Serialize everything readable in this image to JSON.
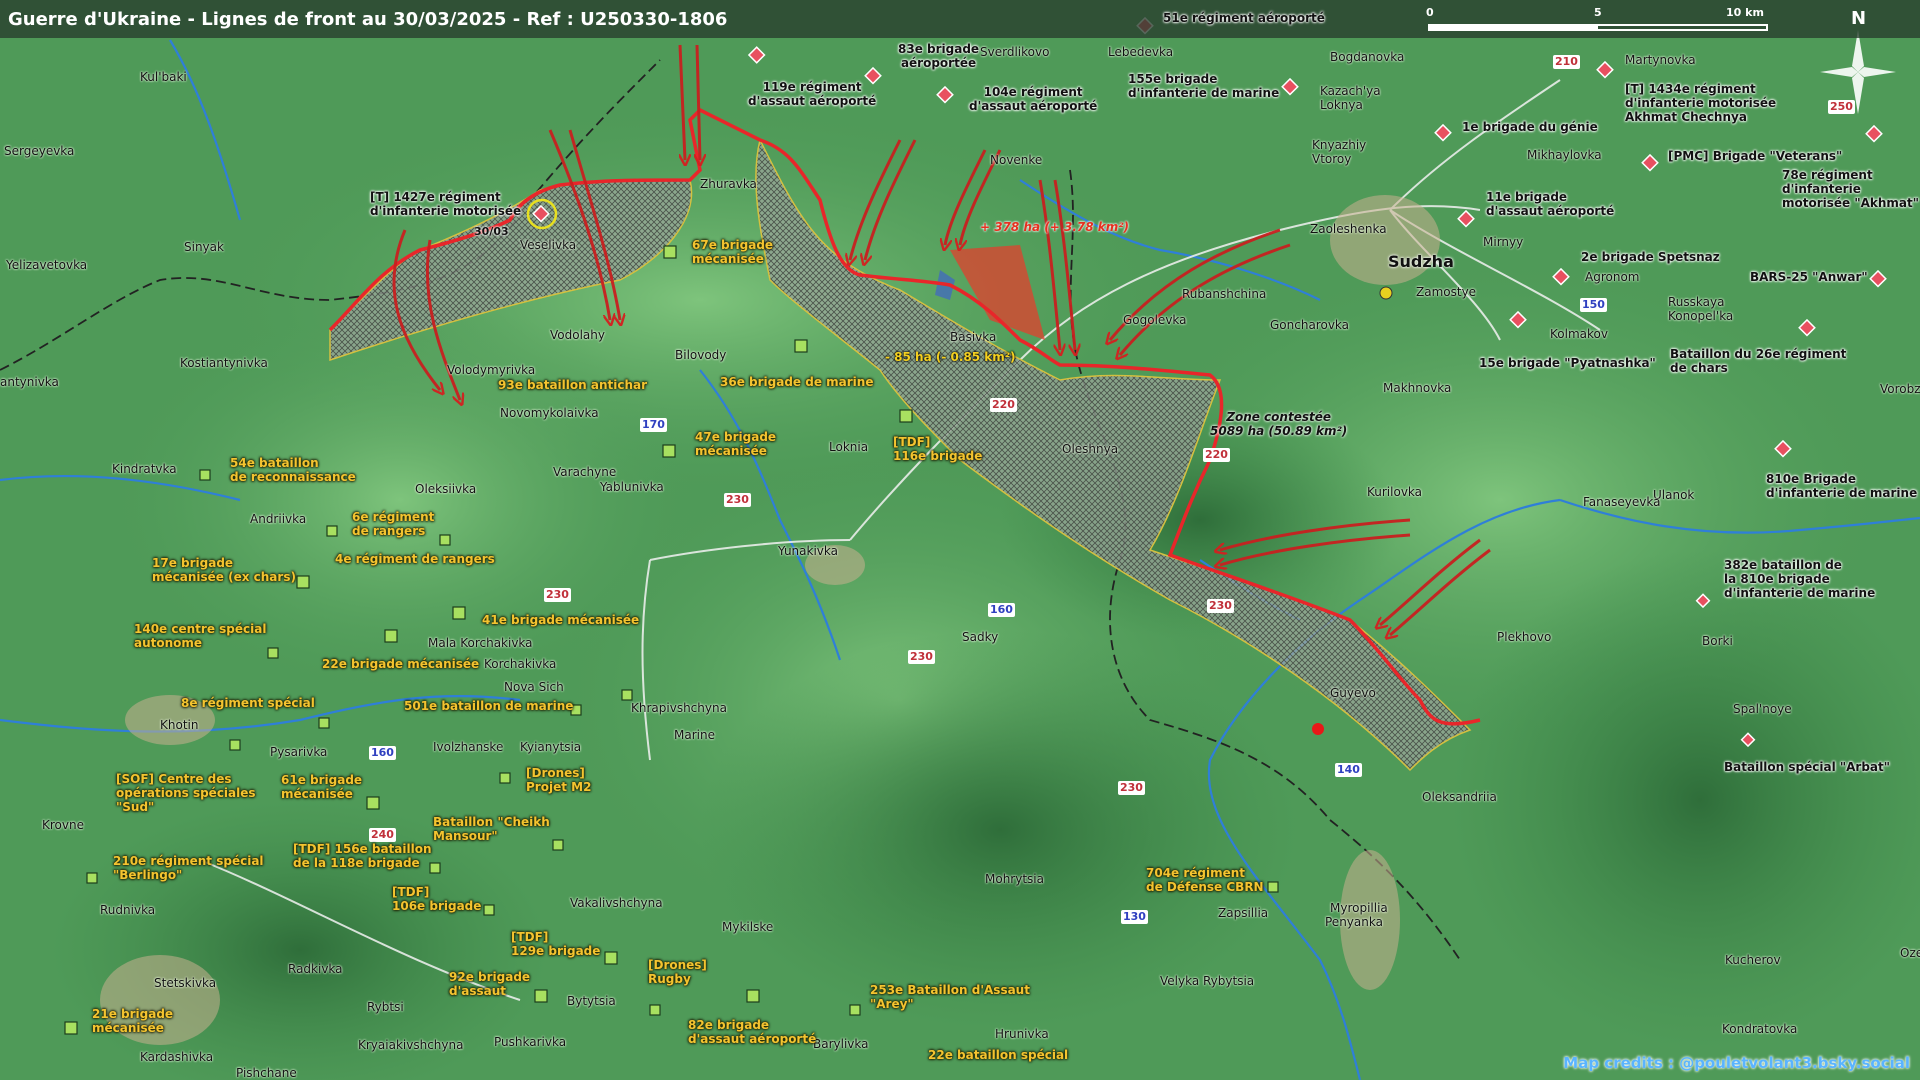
{
  "title": "Guerre d'Ukraine - Lignes de front au 30/03/2025 - Ref : U250330-1806",
  "scale": {
    "ticks": [
      "0",
      "5",
      "10 km"
    ]
  },
  "north": "N",
  "credits": "Map credits : @pouletvolant3.bsky.social",
  "zone_contested": "Zone contestée\n5089 ha (50.89 km²)",
  "gain_label": "+ 378 ha (+ 3.78 km²)",
  "loss_label": "- 85 ha (- 0.85 km²)",
  "date_label": "30/03",
  "main_town": "Sudzha",
  "places": {
    "kulbaki": "Kul'baki",
    "sergeyevka": "Sergeyevka",
    "sinyak": "Sinyak",
    "yelizavetovka": "Yelizavetovka",
    "kostiantynivka": "Kostiantynivka",
    "antynivka": "antynivka",
    "veselivka": "Veselivka",
    "zhuravka": "Zhuravka",
    "sverdlikovo": "Sverdlikovo",
    "lebedevka": "Lebedevka",
    "bogdanovka": "Bogdanovka",
    "martynovka": "Martynovka",
    "kazachya": "Kazach'ya\nLoknya",
    "knyazhiy": "Knyazhiy\nVtoroy",
    "mikhaylovka": "Mikhaylovka",
    "novenke": "Novenke",
    "zaoleshenka": "Zaoleshenka",
    "mirnyy": "Mirnyy",
    "zamostye": "Zamostye",
    "agronom": "Agronom",
    "rubanshchina": "Rubanshchina",
    "goncharovka": "Goncharovka",
    "russkaya": "Russkaya\nKonopel'ka",
    "kolmakov": "Kolmakov",
    "gogolevka": "Gogolevka",
    "basivka": "Basivka",
    "vodolahy": "Vodolahy",
    "bilovody": "Bilovody",
    "volodymyrivka": "Volodymyrivka",
    "novomykolaivka": "Novomykolaivka",
    "makhnovka": "Makhnovka",
    "oleshnya": "Oleshnya",
    "loknia": "Loknia",
    "varachyne": "Varachyne",
    "yablunivka": "Yablunivka",
    "kindratvka": "Kindratvka",
    "oleksiivka": "Oleksiivka",
    "andriivka": "Andriivka",
    "kurilovka": "Kurilovka",
    "ulanok": "Ulanok",
    "fanaseyevka": "Fanaseyevka",
    "vorobzha": "Vorobzha",
    "yunakivka": "Yunakivka",
    "sadky": "Sadky",
    "plekhovo": "Plekhovo",
    "borki": "Borki",
    "guyevo": "Guyevo",
    "spalnoye": "Spal'noye",
    "mala_korchakivka": "Mala Korchakivka",
    "korchakivka": "Korchakivka",
    "nova_sich": "Nova Sich",
    "khrapivshchyna": "Khrapivshchyna",
    "khotin": "Khotin",
    "pysarivka": "Pysarivka",
    "ivolzhanske": "Ivolzhanske",
    "kyianytsia": "Kyianytsia",
    "marine": "Marine",
    "oleksandriia": "Oleksandriia",
    "krovne": "Krovne",
    "rudnivka": "Rudnivka",
    "mohrytsia": "Mohrytsia",
    "vakalivshchyna": "Vakalivshchyna",
    "zapsillia": "Zapsillia",
    "myropillia": "Myropillia",
    "penyanka": "Penyanka",
    "mykilske": "Mykilske",
    "kucherov": "Kucherov",
    "stetskivka": "Stetskivka",
    "radkivka": "Radkivka",
    "rybtsi": "Rybtsi",
    "bytytsia": "Bytytsia",
    "velyka_rybytsia": "Velyka Rybytsia",
    "kryaiakivshchyna": "Kryaiakivshchyna",
    "pushkarivka": "Pushkarivka",
    "barylivka": "Barylivka",
    "hrunivka": "Hrunivka",
    "kondratovka": "Kondratovka",
    "kardashivka": "Kardashivka",
    "pishchane": "Pishchane",
    "oze": "Oze"
  },
  "roads": {
    "r210": "210",
    "r250": "250",
    "r150": "150",
    "r220a": "220",
    "r220b": "220",
    "r170": "170",
    "r230a": "230",
    "r230b": "230",
    "r230c": "230",
    "r230d": "230",
    "r160a": "160",
    "r160b": "160",
    "r140": "140",
    "r240": "240",
    "r130": "130"
  },
  "ru_units": {
    "u1": "51e régiment aéroporté",
    "u2": "83e brigade\naéroportée",
    "u3": "119e régiment\nd'assaut aéroporté",
    "u4": "104e régiment\nd'assaut aéroporté",
    "u5": "155e brigade\nd'infanterie de marine",
    "u6": "[T] 1434e régiment\nd'infanterie motorisée\nAkhmat Chechnya",
    "u7": "1e brigade du génie",
    "u8": "[PMC] Brigade \"Veterans\"",
    "u9": "78e régiment\nd'infanterie\nmotorisée \"Akhmat\"",
    "u10": "11e brigade\nd'assaut aéroporté",
    "u11": "2e brigade Spetsnaz",
    "u12": "BARS-25 \"Anwar\"",
    "u13": "15e brigade \"Pyatnashka\"",
    "u14": "Bataillon du 26e régiment\nde chars",
    "u15": "810e Brigade\nd'infanterie de marine",
    "u16": "382e bataillon de\nla 810e brigade\nd'infanterie de marine",
    "u17": "Bataillon spécial \"Arbat\"",
    "u18": "[T] 1427e régiment\nd'infanterie motorisée"
  },
  "ua_units": {
    "a1": "67e brigade\nmécanisée",
    "a2": "93e bataillon antichar",
    "a3": "36e brigade de marine",
    "a4": "47e brigade\nmécanisée",
    "a5": "[TDF]\n116e brigade",
    "a6": "54e bataillon\nde reconnaissance",
    "a7": "6e régiment\nde rangers",
    "a8": "4e régiment de rangers",
    "a9": "17e brigade\nmécanisée (ex chars)",
    "a10": "41e brigade mécanisée",
    "a11": "140e centre spécial\nautonome",
    "a12": "22e brigade mécanisée",
    "a13": "8e régiment spécial",
    "a14": "501e bataillon de marine",
    "a15": "[SOF] Centre des\nopérations spéciales\n\"Sud\"",
    "a16": "61e brigade\nmécanisée",
    "a17": "[Drones]\nProjet M2",
    "a18": "Bataillon \"Cheikh\nMansour\"",
    "a19": "210e régiment spécial\n\"Berlingo\"",
    "a20": "[TDF] 156e bataillon\nde la 118e brigade",
    "a21": "[TDF]\n106e brigade",
    "a22": "[TDF]\n129e brigade",
    "a23": "[Drones]\nRugby",
    "a24": "92e brigade\nd'assaut",
    "a25": "253e Bataillon d'Assaut\n\"Arey\"",
    "a26": "704e régiment\nde Défense CBRN",
    "a27": "21e brigade\nmécanisée",
    "a28": "82e brigade\nd'assaut aéroporté",
    "a29": "22e bataillon spécial"
  },
  "colors": {
    "front_line": "#e8262a",
    "contested_fill": "#8f9a8f",
    "ru_unit": "#e85060",
    "ua_unit": "#a8e060",
    "ua_label": "#f4c430",
    "river": "#2f7fd8",
    "border": "#222222"
  }
}
